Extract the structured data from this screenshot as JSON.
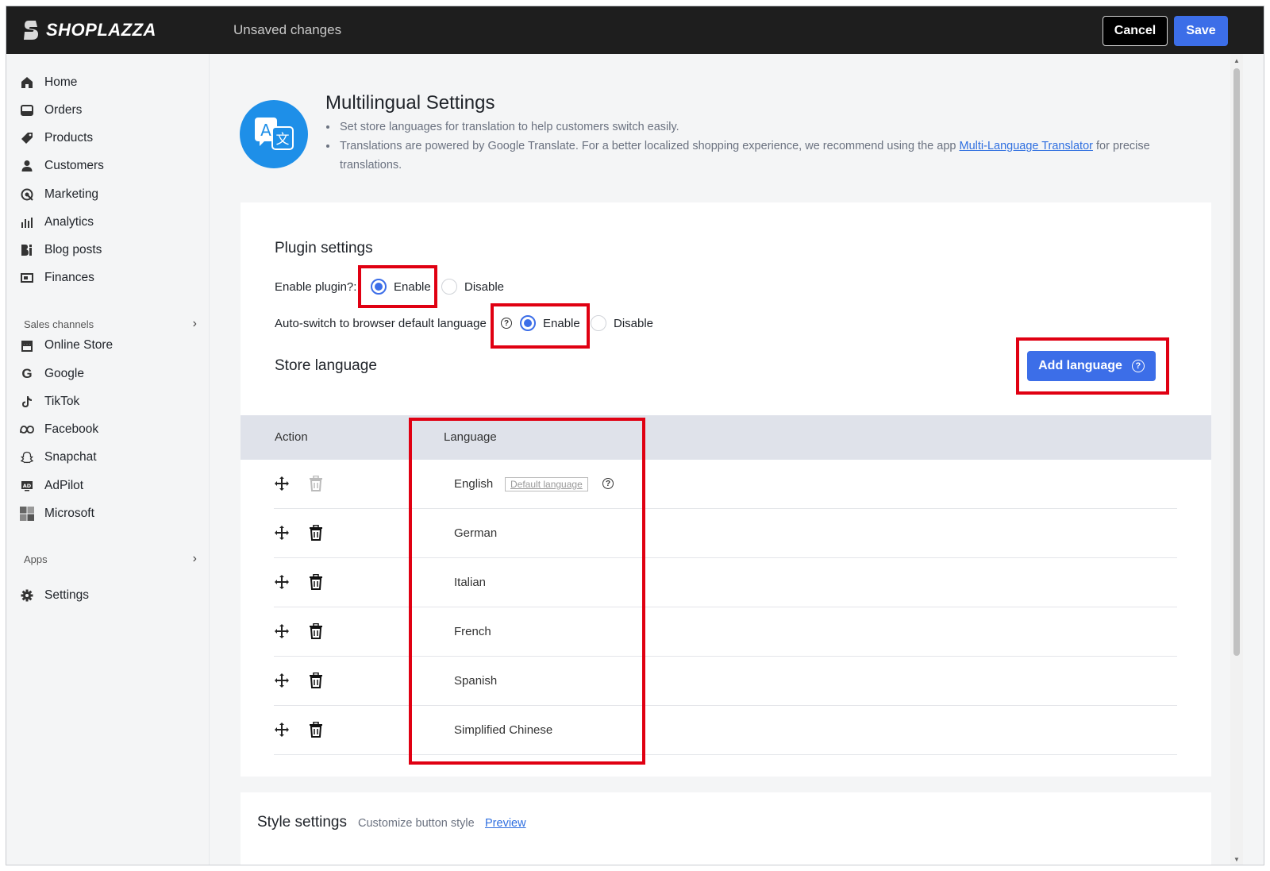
{
  "topbar": {
    "brand": "SHOPLAZZA",
    "status": "Unsaved changes",
    "cancel_label": "Cancel",
    "save_label": "Save"
  },
  "sidebar": {
    "items": [
      {
        "label": "Home",
        "icon": "home-icon"
      },
      {
        "label": "Orders",
        "icon": "orders-icon"
      },
      {
        "label": "Products",
        "icon": "tag-icon"
      },
      {
        "label": "Customers",
        "icon": "person-icon"
      },
      {
        "label": "Marketing",
        "icon": "marketing-icon"
      },
      {
        "label": "Analytics",
        "icon": "bar-chart-icon"
      },
      {
        "label": "Blog posts",
        "icon": "blog-icon"
      },
      {
        "label": "Finances",
        "icon": "finance-icon"
      }
    ],
    "sales_channels_label": "Sales channels",
    "channels": [
      {
        "label": "Online Store",
        "icon": "store-icon"
      },
      {
        "label": "Google",
        "icon": "google-icon"
      },
      {
        "label": "TikTok",
        "icon": "tiktok-icon"
      },
      {
        "label": "Facebook",
        "icon": "meta-icon"
      },
      {
        "label": "Snapchat",
        "icon": "snapchat-icon"
      },
      {
        "label": "AdPilot",
        "icon": "adpilot-icon"
      },
      {
        "label": "Microsoft",
        "icon": "microsoft-icon"
      }
    ],
    "apps_label": "Apps",
    "settings_label": "Settings"
  },
  "header": {
    "title": "Multilingual Settings",
    "bullet1": "Set store languages for translation to help customers switch easily.",
    "bullet2_pre": "Translations are powered by Google Translate. For a better localized shopping experience, we recommend using the app ",
    "bullet2_link": "Multi-Language Translator",
    "bullet2_post": " for precise translations."
  },
  "plugin": {
    "section_title": "Plugin settings",
    "enable_label": "Enable plugin?:",
    "enable_option": "Enable",
    "disable_option": "Disable",
    "enable_selected": "Enable",
    "autoswitch_label": "Auto-switch to browser default language",
    "autoswitch_selected": "Enable"
  },
  "store_language": {
    "section_title": "Store language",
    "add_button": "Add language",
    "col_action": "Action",
    "col_language": "Language",
    "default_badge": "Default language",
    "languages": [
      "English",
      "German",
      "Italian",
      "French",
      "Spanish",
      "Simplified Chinese"
    ]
  },
  "style_settings": {
    "title": "Style settings",
    "subtitle": "Customize button style",
    "preview_link": "Preview"
  },
  "colors": {
    "accent": "#3c6ee8",
    "highlight": "#e00012",
    "topbar": "#1e1e1e"
  }
}
